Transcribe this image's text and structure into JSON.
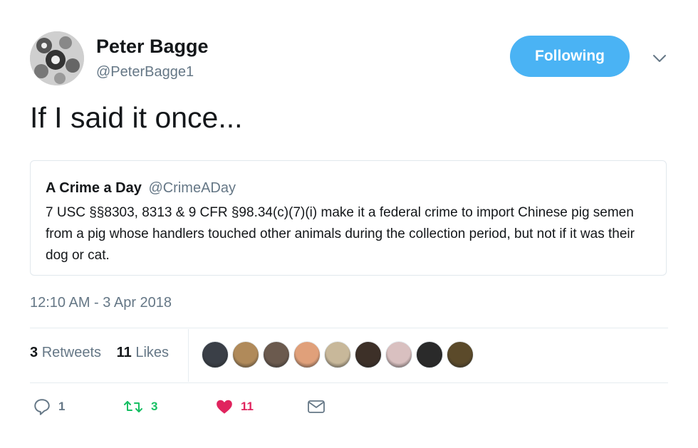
{
  "author": {
    "name": "Peter Bagge",
    "handle": "@PeterBagge1"
  },
  "follow_button": {
    "label": "Following"
  },
  "tweet": {
    "text": "If I said it once..."
  },
  "quoted_tweet": {
    "name": "A Crime a Day",
    "handle": "@CrimeADay",
    "text": "7 USC §§8303, 8313 & 9 CFR §98.34(c)(7)(i) make it a federal crime to import Chinese pig semen from a pig whose handlers touched other animals during the collection period, but not if it was their dog or cat."
  },
  "timestamp": "12:10 AM - 3 Apr 2018",
  "stats": {
    "retweets_count": "3",
    "retweets_label": "Retweets",
    "likes_count": "11",
    "likes_label": "Likes"
  },
  "likers": [
    {
      "icon": "liker-avatar",
      "color": "#3a3f47"
    },
    {
      "icon": "liker-avatar",
      "color": "#b08a5a"
    },
    {
      "icon": "liker-avatar",
      "color": "#6b5a4e"
    },
    {
      "icon": "liker-avatar",
      "color": "#e0a07a"
    },
    {
      "icon": "liker-avatar",
      "color": "#c8b89a"
    },
    {
      "icon": "liker-avatar",
      "color": "#3d3028"
    },
    {
      "icon": "liker-avatar",
      "color": "#d9c0c0"
    },
    {
      "icon": "liker-avatar",
      "color": "#2a2a2a"
    },
    {
      "icon": "liker-avatar",
      "color": "#5b4a2a"
    }
  ],
  "actions": {
    "reply_count": "1",
    "retweet_count": "3",
    "like_count": "11"
  },
  "colors": {
    "accent": "#4ab3f4",
    "retweet": "#17bf63",
    "like": "#e0245e",
    "secondary_text": "#657786"
  }
}
